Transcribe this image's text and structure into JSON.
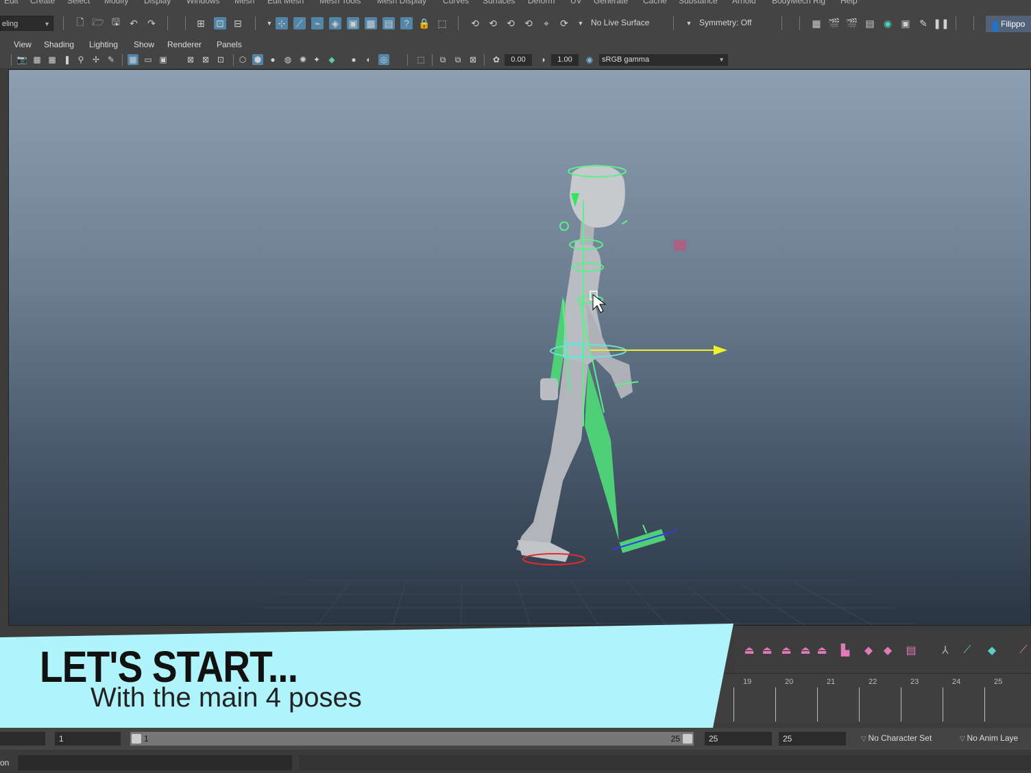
{
  "menubar": {
    "items": [
      "Edit",
      "Create",
      "Select",
      "Modify",
      "Display",
      "Windows",
      "Mesh",
      "Edit Mesh",
      "Mesh Tools",
      "Mesh Display",
      "Curves",
      "Surfaces",
      "Deform",
      "UV",
      "Generate",
      "Cache",
      "Substance",
      "Arnold",
      "BodyMech Rig",
      "Help"
    ]
  },
  "statusline": {
    "mode": "eling",
    "live_surface": "No Live Surface",
    "symmetry": "Symmetry: Off",
    "user": "Filippo"
  },
  "panel_menu": {
    "items": [
      "View",
      "Shading",
      "Lighting",
      "Show",
      "Renderer",
      "Panels"
    ]
  },
  "panel_toolbar": {
    "exposure": "0.00",
    "gamma": "1.00",
    "color_space": "sRGB gamma"
  },
  "banner": {
    "title": "LET'S START...",
    "subtitle": "With the main 4 poses"
  },
  "timeline": {
    "frames": [
      "19",
      "20",
      "21",
      "22",
      "23",
      "24",
      "25"
    ]
  },
  "range": {
    "start": "1",
    "range_start": "1",
    "range_end": "25",
    "end": "25",
    "anim_end": "25",
    "character_set": "No Character Set",
    "anim_layer": "No Anim Laye"
  },
  "cmdline": {
    "label": "on"
  },
  "colors": {
    "banner": "#b0f4fb",
    "controls_green": "#5cf08a",
    "highlight_blue": "#5285a6",
    "move_arrow": "#f0f02a"
  }
}
